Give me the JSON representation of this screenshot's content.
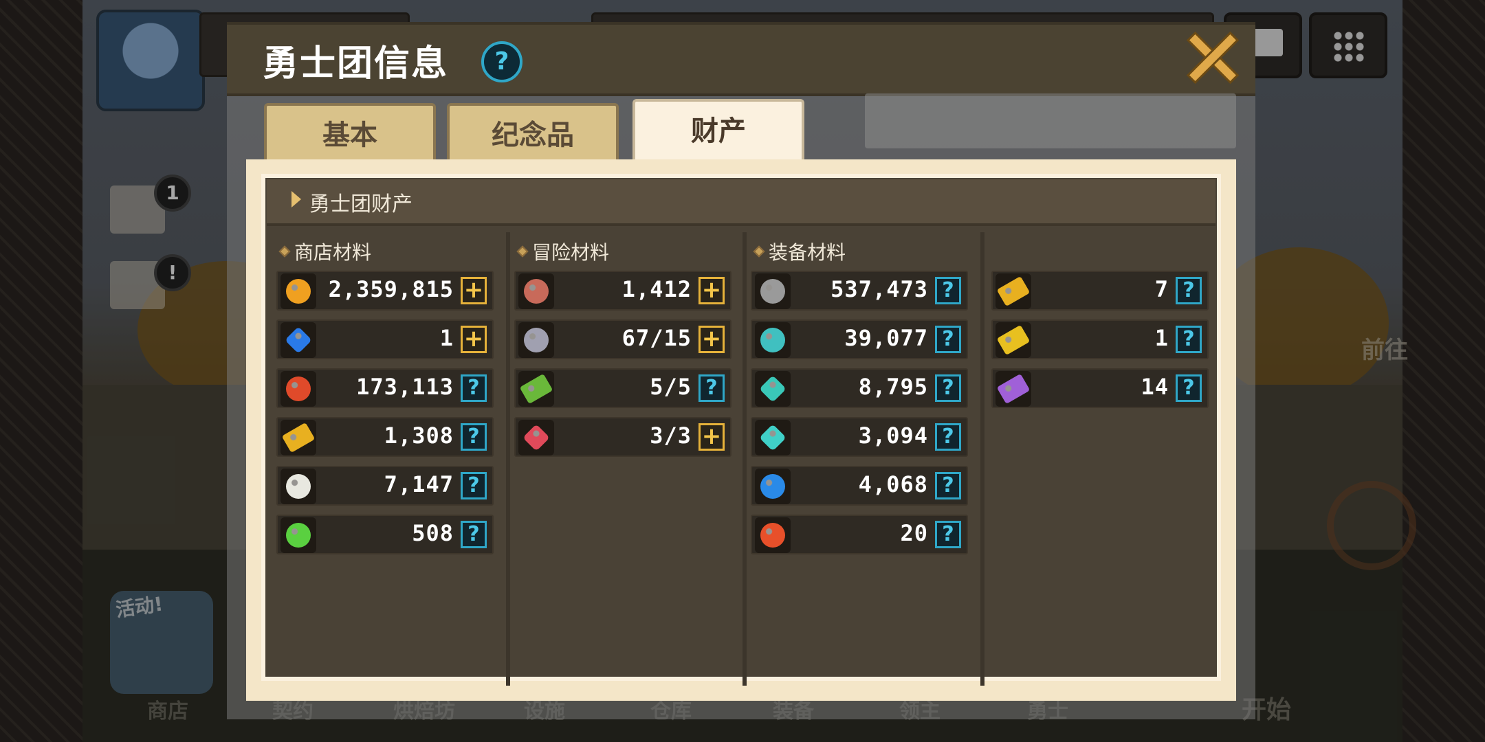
{
  "window": {
    "title": "勇士团信息",
    "help_glyph": "?"
  },
  "tabs": [
    {
      "label": "基本",
      "active": false
    },
    {
      "label": "纪念品",
      "active": false
    },
    {
      "label": "财产",
      "active": true
    }
  ],
  "panel": {
    "title": "勇士团财产"
  },
  "columns": [
    {
      "title": "商店材料",
      "items": [
        {
          "icon": "gold-coin-icon",
          "value": "2,359,815",
          "action": "plus"
        },
        {
          "icon": "blue-gem-icon",
          "value": "1",
          "action": "plus"
        },
        {
          "icon": "medal-icon",
          "value": "173,113",
          "action": "help"
        },
        {
          "icon": "gold-ticket-icon",
          "value": "1,308",
          "action": "help"
        },
        {
          "icon": "fish-bone-icon",
          "value": "7,147",
          "action": "help"
        },
        {
          "icon": "green-orb-icon",
          "value": "508",
          "action": "help"
        }
      ]
    },
    {
      "title": "冒险材料",
      "items": [
        {
          "icon": "meat-icon",
          "value": "1,412",
          "action": "plus"
        },
        {
          "icon": "key-icon",
          "value": "67/15",
          "action": "plus"
        },
        {
          "icon": "green-ticket-icon",
          "value": "5/5",
          "action": "help"
        },
        {
          "icon": "red-crystal-icon",
          "value": "3/3",
          "action": "plus"
        }
      ]
    },
    {
      "title": "装备材料",
      "items": [
        {
          "icon": "iron-ore-icon",
          "value": "537,473",
          "action": "help"
        },
        {
          "icon": "teal-powder-icon",
          "value": "39,077",
          "action": "help"
        },
        {
          "icon": "teal-crystal-icon",
          "value": "8,795",
          "action": "help"
        },
        {
          "icon": "teal-gem-icon",
          "value": "3,094",
          "action": "help"
        },
        {
          "icon": "blue-orb-icon",
          "value": "4,068",
          "action": "help"
        },
        {
          "icon": "fire-orb-icon",
          "value": "20",
          "action": "help"
        }
      ]
    },
    {
      "title": "",
      "items": [
        {
          "icon": "gold-ticket-icon",
          "value": "7",
          "action": "help"
        },
        {
          "icon": "gold-star-ticket-icon",
          "value": "1",
          "action": "help"
        },
        {
          "icon": "purple-ticket-icon",
          "value": "14",
          "action": "help"
        }
      ]
    }
  ],
  "action_glyphs": {
    "plus": "+",
    "help": "?"
  },
  "colors": {
    "gold-coin-icon": "#f0a020",
    "blue-gem-icon": "#2a7ae8",
    "medal-icon": "#e04a2a",
    "gold-ticket-icon": "#e8b020",
    "fish-bone-icon": "#e8e8e0",
    "green-orb-icon": "#5ad040",
    "meat-icon": "#c86a5a",
    "key-icon": "#a0a0b0",
    "green-ticket-icon": "#6ab83a",
    "red-crystal-icon": "#e04a5a",
    "iron-ore-icon": "#9a9a9a",
    "teal-powder-icon": "#40c0c0",
    "teal-crystal-icon": "#3ac8b8",
    "teal-gem-icon": "#40d0c8",
    "blue-orb-icon": "#2a8ae8",
    "fire-orb-icon": "#e8502a",
    "gold-star-ticket-icon": "#e8c020",
    "purple-ticket-icon": "#a060d8"
  },
  "background": {
    "bottom_nav": [
      "商店",
      "契约",
      "烘焙坊",
      "设施",
      "仓库",
      "装备",
      "领主",
      "勇士"
    ],
    "start_label": "开始",
    "front_label": "前往",
    "activity_label": "活动!",
    "mail_badge": "1",
    "alert_badge": "!"
  }
}
